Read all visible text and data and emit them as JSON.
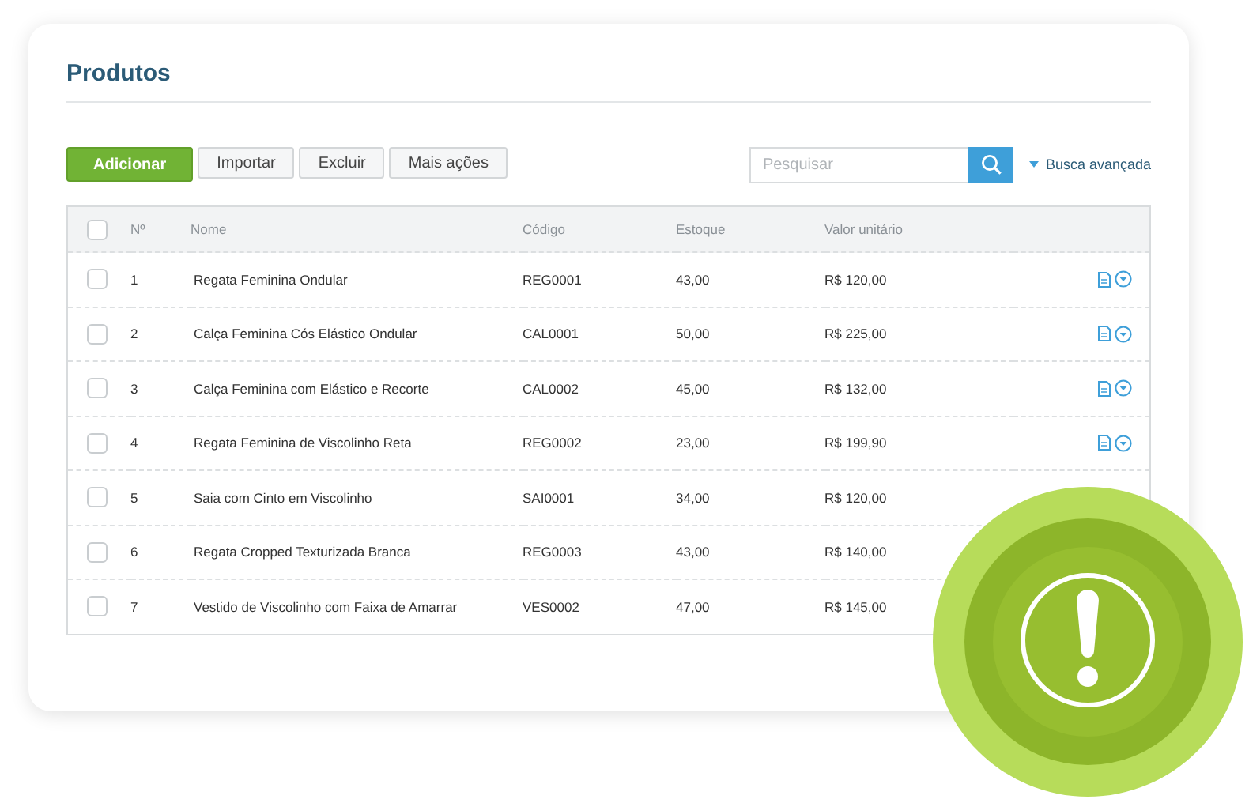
{
  "title": "Produtos",
  "toolbar": {
    "buttons": [
      {
        "label": "Adicionar",
        "kind": "primary"
      },
      {
        "label": "Importar",
        "kind": "default"
      },
      {
        "label": "Excluir",
        "kind": "default"
      },
      {
        "label": "Mais ações",
        "kind": "default"
      }
    ],
    "search": {
      "placeholder": "Pesquisar"
    },
    "advanced_search": "Busca avançada"
  },
  "table": {
    "header_checked": false,
    "columns": [
      "Nº",
      "Nome",
      "Código",
      "Estoque",
      "Valor unitário"
    ],
    "rows": [
      {
        "checked": false,
        "cells": [
          "1",
          "Regata Feminina Ondular",
          "REG0001",
          "43,00",
          "R$ 120,00"
        ],
        "actions": true
      },
      {
        "checked": false,
        "cells": [
          "2",
          "Calça Feminina Cós Elástico Ondular",
          "CAL0001",
          "50,00",
          "R$ 225,00"
        ],
        "actions": true
      },
      {
        "checked": false,
        "cells": [
          "3",
          "Calça Feminina com Elástico e Recorte",
          "CAL0002",
          "45,00",
          "R$ 132,00"
        ],
        "actions": true
      },
      {
        "checked": false,
        "cells": [
          "4",
          "Regata Feminina de Viscolinho Reta",
          "REG0002",
          "23,00",
          "R$ 199,90"
        ],
        "actions": true
      },
      {
        "checked": false,
        "cells": [
          "5",
          "Saia com Cinto em Viscolinho",
          "SAI0001",
          "34,00",
          "R$ 120,00"
        ],
        "actions": false
      },
      {
        "checked": false,
        "cells": [
          "6",
          "Regata Cropped Texturizada Branca",
          "REG0003",
          "43,00",
          "R$ 140,00"
        ],
        "actions": false
      },
      {
        "checked": false,
        "cells": [
          "7",
          "Vestido de Viscolinho com Faixa de Amarrar",
          "VES0002",
          "47,00",
          "R$ 145,00"
        ],
        "actions": false
      }
    ]
  },
  "alert_badge": {
    "kind": "warning"
  }
}
